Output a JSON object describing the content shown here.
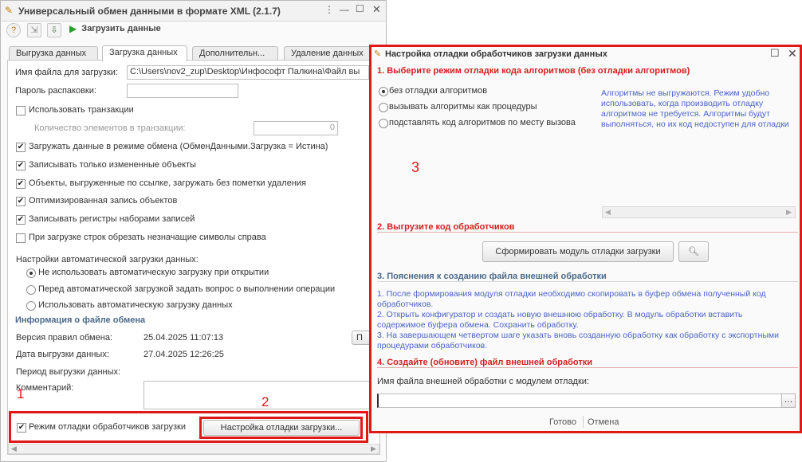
{
  "main": {
    "title": "Универсальный обмен данными в формате XML (2.1.7)",
    "toolbar": {
      "load_label": "Загрузить данные"
    },
    "tabs": [
      "Выгрузка данных",
      "Загрузка данных",
      "Дополнительн...",
      "Удаление данных"
    ],
    "fields": {
      "file_label": "Имя файла для загрузки:",
      "file_value": "C:\\Users\\nov2_zup\\Desktop\\Инфософт Палкина\\Файл вы",
      "password_label": "Пароль распаковки:",
      "password_value": "",
      "count_label": "Количество элементов в транзакции:",
      "count_value": "0"
    },
    "checkboxes": [
      {
        "label": "Использовать транзакции",
        "checked": false
      },
      {
        "label": "Загружать данные в режиме обмена (ОбменДанными.Загрузка = Истина)",
        "checked": true
      },
      {
        "label": "Записывать только измененные объекты",
        "checked": true
      },
      {
        "label": "Объекты, выгруженные по ссылке, загружать без пометки удаления",
        "checked": true
      },
      {
        "label": "Оптимизированная запись объектов",
        "checked": true
      },
      {
        "label": "Записывать регистры наборами записей",
        "checked": true
      },
      {
        "label": "При загрузке строк обрезать незначащие символы справа",
        "checked": false
      }
    ],
    "auto_label": "Настройки автоматической загрузки данных:",
    "radios": [
      {
        "label": "Не использовать автоматическую загрузку при открытии",
        "on": true
      },
      {
        "label": "Перед автоматической загрузкой задать вопрос о выполнении операции",
        "on": false
      },
      {
        "label": "Использовать автоматическую загрузку данных",
        "on": false
      }
    ],
    "info_header": "Информация о файле обмена",
    "info": {
      "rules_label": "Версия правил обмена:",
      "rules_value": "25.04.2025 11:07:13",
      "date_label": "Дата выгрузки данных:",
      "date_value": "27.04.2025 12:26:25",
      "period_label": "Период выгрузки данных:",
      "comment_label": "Комментарий:",
      "side_button": "П"
    },
    "debug_check": {
      "label": "Режим отладки обработчиков загрузки",
      "checked": true
    },
    "debug_button": "Настройка отладки загрузки..."
  },
  "annotations": [
    "1",
    "2",
    "3"
  ],
  "dialog": {
    "title": "Настройка отладки обработчиков загрузки данных",
    "s1": "1. Выберите режим отладки кода алгоритмов (без отладки алгоритмов)",
    "s1_radios": [
      {
        "label": "без отладки алгоритмов",
        "on": true
      },
      {
        "label": "вызывать алгоритмы как процедуры",
        "on": false
      },
      {
        "label": "подставлять код алгоритмов по месту вызова",
        "on": false
      }
    ],
    "s1_desc": "Алгоритмы не выгружаются. Режим удобно использовать, когда производить отладку алгоритмов не требуется. Алгоритмы будут выполняться, но их код недоступен для отладки",
    "s2": "2. Выгрузите код обработчиков",
    "s2_button": "Сформировать модуль отладки загрузки",
    "s3": "3. Пояснения к созданию файла внешней обработки",
    "s3_text": [
      "1. После формирования модуля отладки необходимо скопировать в буфер обмена полученный код обработчиков.",
      "2. Открыть конфигуратор и создать новую внешнюю обработку. В модуль обработки вставить содержимое буфера обмена. Сохранить обработку.",
      "3. На завершающем четвертом шаге указать вновь созданную обработку как обработку с экспортными процедурами обработчиков."
    ],
    "s4": "4. Создайте (обновите) файл внешней обработки",
    "s4_label": "Имя файла внешней обработки с модулем отладки:",
    "s4_value": "",
    "ok": "Готово",
    "cancel": "Отмена"
  }
}
